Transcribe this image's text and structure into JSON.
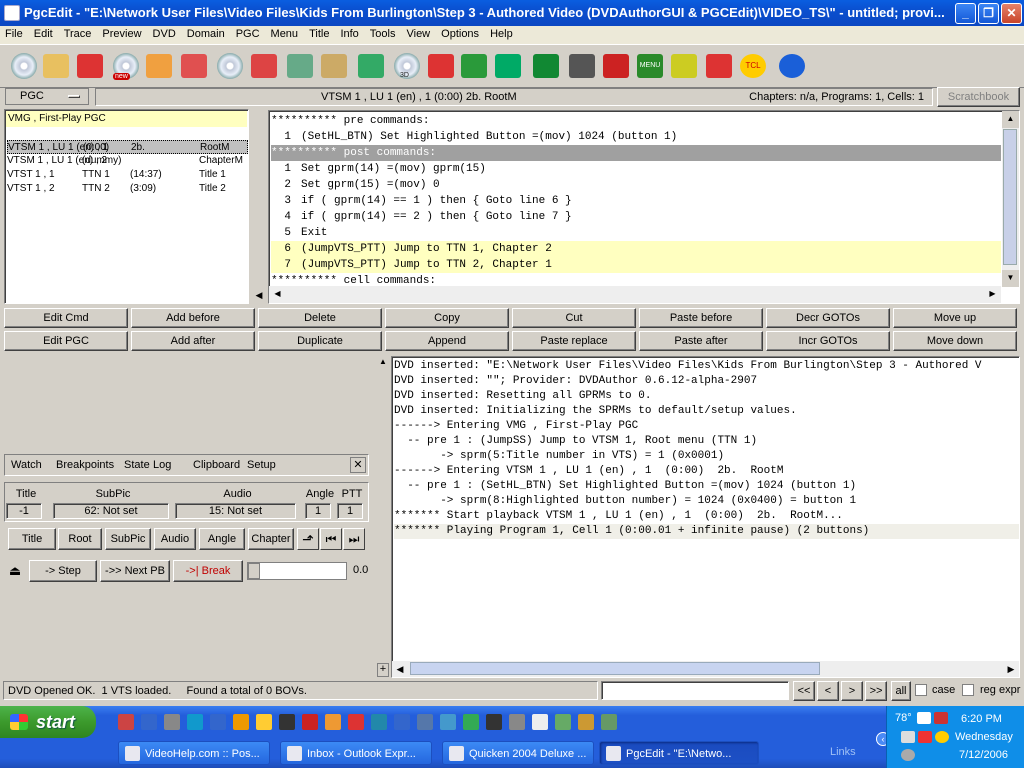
{
  "window": {
    "title": "PgcEdit -  \"E:\\Network User Files\\Video Files\\Kids From Burlington\\Step 3 - Authored Video (DVDAuthorGUI & PGCEdit)\\VIDEO_TS\\\" - untitled; provi..."
  },
  "menu": [
    "File",
    "Edit",
    "Trace",
    "Preview",
    "DVD",
    "Domain",
    "PGC",
    "Menu",
    "Title",
    "Info",
    "Tools",
    "View",
    "Options",
    "Help"
  ],
  "toolbar": {
    "icons": [
      "open-disc-icon",
      "folder-open-icon",
      "reload-icon",
      "new-disc-icon",
      "home-icon",
      "search-icon",
      "multi-disc-icon",
      "bookmark-icon",
      "pen-edit-icon",
      "pen-alt-icon",
      "checkmark-icon",
      "disc-3d-icon",
      "copy-pages-icon",
      "globe-icon",
      "play-preview-icon",
      "film-reel-icon",
      "list-check-icon",
      "cross-tool-icon",
      "menu-icon",
      "link-icon",
      "numbers-icon",
      "tcl-icon",
      "jump-icon"
    ],
    "new_label": "new",
    "d3_label": "3D",
    "menu_label": "MENU",
    "tcl_label": "TCL"
  },
  "pgc_bar": {
    "domain_select": "PGC",
    "current": "VTSM 1 , LU 1 (en) , 1  (0:00)  2b.  RootM",
    "stats": "Chapters: n/a,  Programs: 1,  Cells: 1",
    "scratchbook": "Scratchbook"
  },
  "pgc_list": {
    "header": "VMG , First-Play PGC",
    "rows": [
      [
        "VTSM 1 , LU 1 (en) , 1",
        "(0:00)",
        "2b.",
        "RootM"
      ],
      [
        "VTSM 1 , LU 1 (en) , 2",
        "(dummy)",
        "",
        "ChapterM"
      ],
      [
        "VTST 1 , 1",
        "TTN 1",
        "(14:37)",
        "Title 1"
      ],
      [
        "VTST 1 , 2",
        "TTN 2",
        "(3:09)",
        "Title 2"
      ]
    ]
  },
  "commands": {
    "pre_header": "********** pre commands:",
    "pre": [
      [
        "1",
        "(SetHL_BTN) Set Highlighted Button =(mov) 1024 (button 1)"
      ]
    ],
    "post_header": "********** post commands:",
    "post": [
      [
        "1",
        "Set gprm(14) =(mov) gprm(15)"
      ],
      [
        "2",
        "Set gprm(15) =(mov) 0"
      ],
      [
        "3",
        "if ( gprm(14) == 1 ) then { Goto line 6 }"
      ],
      [
        "4",
        "if ( gprm(14) == 2 ) then { Goto line 7 }"
      ],
      [
        "5",
        "Exit"
      ],
      [
        "6",
        "(JumpVTS_PTT) Jump to TTN 1, Chapter 2"
      ],
      [
        "7",
        "(JumpVTS_PTT) Jump to TTN 2, Chapter 1"
      ]
    ],
    "cell_header": "********** cell commands:"
  },
  "edit_buttons": {
    "row1": [
      "Edit Cmd",
      "Add before",
      "Delete",
      "Copy",
      "Cut",
      "Paste before",
      "Decr GOTOs",
      "Move up"
    ],
    "row2": [
      "Edit PGC",
      "Add after",
      "Duplicate",
      "Append",
      "Paste replace",
      "Paste after",
      "Incr GOTOs",
      "Move down"
    ]
  },
  "trace": {
    "tabs": [
      "Watch",
      "Breakpoints",
      "State",
      "Log",
      "Clipboard",
      "Setup"
    ],
    "headers": [
      "Title",
      "SubPic",
      "Audio",
      "Angle",
      "PTT"
    ],
    "values": [
      "-1",
      "62: Not set",
      "15: Not set",
      "1",
      "1"
    ],
    "nav_buttons": [
      "Title",
      "Root",
      "SubPic",
      "Audio",
      "Angle",
      "Chapter"
    ],
    "step": "-> Step",
    "next_pb": "->> Next PB",
    "break": "->| Break",
    "slider_value": "0.0"
  },
  "log": {
    "lines": [
      "DVD inserted: \"E:\\Network User Files\\Video Files\\Kids From Burlington\\Step 3 - Authored V",
      "DVD inserted: \"\"; Provider: DVDAuthor 0.6.12-alpha-2907",
      "DVD inserted: Resetting all GPRMs to 0.",
      "DVD inserted: Initializing the SPRMs to default/setup values.",
      "------> Entering VMG , First-Play PGC",
      "  -- pre 1 : (JumpSS) Jump to VTSM 1, Root menu (TTN 1)",
      "       -> sprm(5:Title number in VTS) = 1 (0x0001)",
      "------> Entering VTSM 1 , LU 1 (en) , 1  (0:00)  2b.  RootM",
      "  -- pre 1 : (SetHL_BTN) Set Highlighted Button =(mov) 1024 (button 1)",
      "       -> sprm(8:Highlighted button number) = 1024 (0x0400) = button 1",
      "******* Start playback VTSM 1 , LU 1 (en) , 1  (0:00)  2b.  RootM...",
      "******* Playing Program 1, Cell 1 (0:00.01 + infinite pause) (2 buttons)"
    ]
  },
  "status": {
    "text": "DVD Opened OK.  1 VTS loaded.     Found a total of 0 BOVs.",
    "search_value": "",
    "nav": [
      "<<",
      "<",
      ">",
      ">>"
    ],
    "all": "all",
    "case": "case",
    "reg_expr": "reg expr"
  },
  "taskbar": {
    "start": "start",
    "tasks": [
      "VideoHelp.com :: Pos...",
      "Inbox - Outlook Expr...",
      "Quicken 2004 Deluxe ...",
      "PgcEdit -  \"E:\\Netwo..."
    ],
    "links": "Links",
    "temp": "78°",
    "time": "6:20 PM",
    "day": "Wednesday",
    "date": "7/12/2006"
  },
  "colors": {
    "title_blue": "#0a4fcf",
    "highlight_yellow": "#ffffc0",
    "selected_gray": "#c0c0c0",
    "taskbar_blue": "#245edb",
    "start_green": "#3c9a2c",
    "tray_blue": "#0f8ee8"
  }
}
